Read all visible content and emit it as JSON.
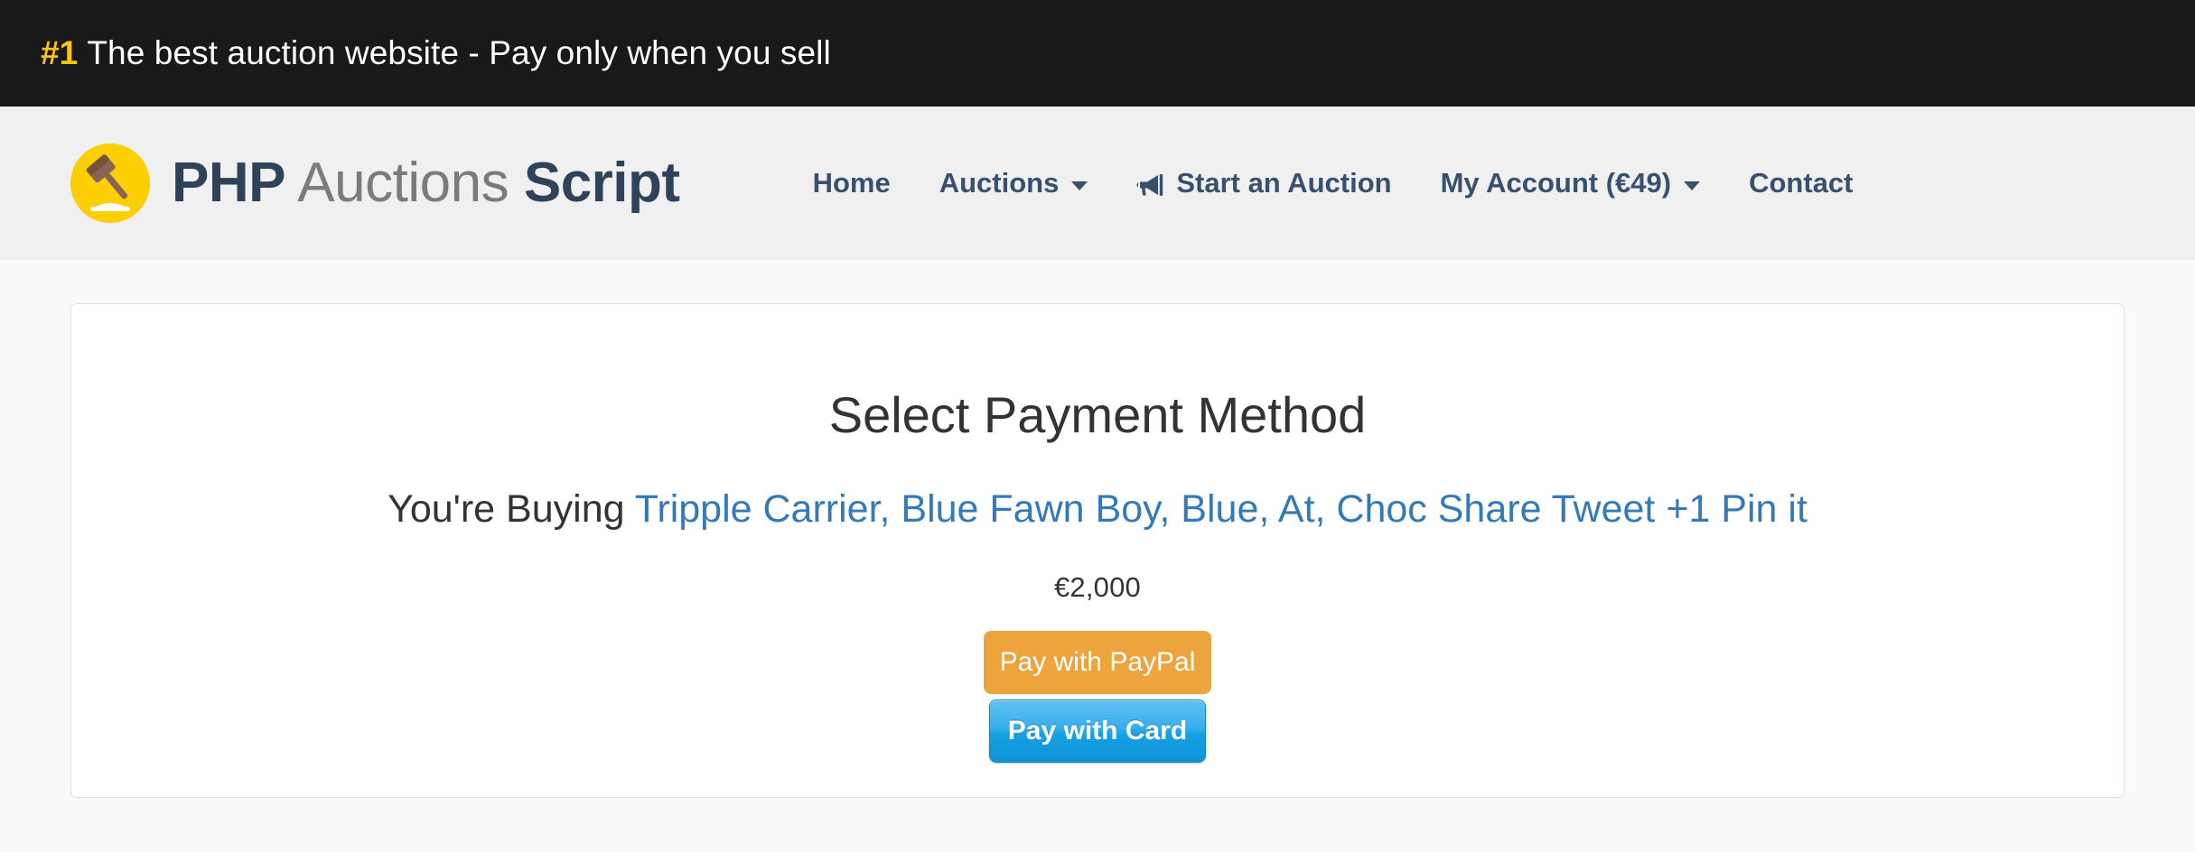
{
  "topbar": {
    "badge": "#1",
    "message": "The best auction website - Pay only when you sell",
    "background": "#191919",
    "badge_color": "#f9c51d"
  },
  "header": {
    "background": "#f0f0f0",
    "brand": {
      "logo_icon": "gavel-icon",
      "part1": "PHP",
      "part2": "Auctions",
      "part3": "Script",
      "bold_color": "#2e4259",
      "light_color": "#7b7b7b"
    },
    "nav": [
      {
        "id": "home",
        "label": "Home",
        "icon": null,
        "caret": false
      },
      {
        "id": "auctions",
        "label": "Auctions",
        "icon": null,
        "caret": true
      },
      {
        "id": "start-an-auction",
        "label": "Start an Auction",
        "icon": "bullhorn-icon",
        "caret": false
      },
      {
        "id": "my-account",
        "label": "My Account (€49)",
        "icon": null,
        "caret": true
      },
      {
        "id": "contact",
        "label": "Contact",
        "icon": null,
        "caret": false
      }
    ],
    "nav_color": "#36506e"
  },
  "main": {
    "panel_title": "Select Payment Method",
    "buying_prefix": "You're Buying ",
    "item_name": "Tripple Carrier, Blue Fawn Boy, Blue, At, Choc Share Tweet +1 Pin it",
    "item_link_color": "#337ab7",
    "price": "€2,000",
    "buttons": {
      "paypal_label": "Pay with PayPal",
      "paypal_color": "#eda43c",
      "card_label": "Pay with Card",
      "card_color": "#16a0e2"
    }
  }
}
